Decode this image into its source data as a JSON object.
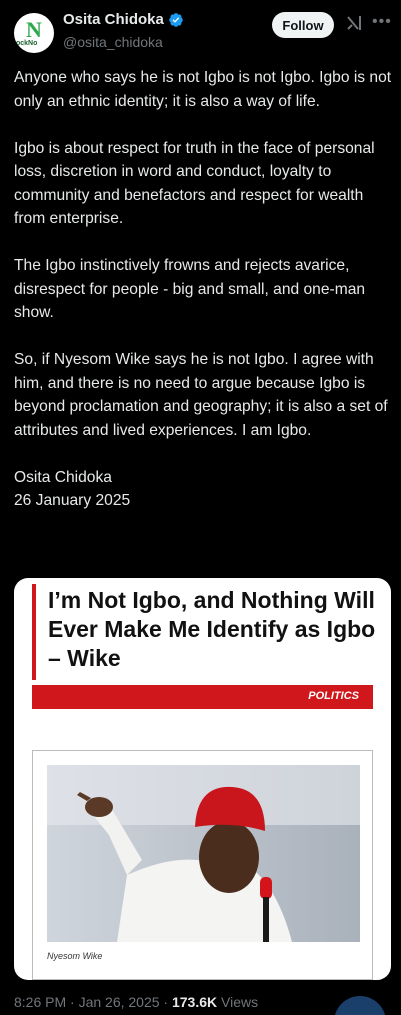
{
  "header": {
    "avatar_text": "N",
    "avatar_small_text": "ockNo",
    "name": "Osita Chidoka",
    "handle": "@osita_chidoka",
    "follow_label": "Follow",
    "icons": {
      "verified": "verified-badge-icon",
      "grok": "grok-icon",
      "more": "more-options-icon"
    }
  },
  "tweet": {
    "paragraphs": [
      "Anyone who says he is not Igbo is not Igbo. Igbo is not only an ethnic identity; it is also a way of life.",
      "Igbo is about respect for truth in the face of personal loss, discretion in word and conduct, loyalty to community and benefactors and respect for wealth from enterprise.",
      "The Igbo instinctively frowns and rejects avarice, disrespect for people - big and small, and one-man show.",
      "So, if  Nyesom Wike says he is not Igbo. I agree with him, and there is no need to argue because Igbo is beyond proclamation and geography; it is also a set of attributes and lived experiences. I am Igbo.",
      "Osita Chidoka\n26 January 2025"
    ]
  },
  "card": {
    "headline": "I’m Not Igbo, and Nothing Will Ever Make Me Identify as Igbo – Wike",
    "category": "POLITICS",
    "photo_caption": "Nyesom Wike"
  },
  "footer": {
    "time": "8:26 PM · Jan 26, 2025 · ",
    "views_count": "173.6K",
    "views_label": " Views"
  },
  "colors": {
    "background": "#000000",
    "text": "#e7e9ea",
    "muted": "#71767b",
    "verified": "#1d9bf0",
    "accent_red": "#d0171c"
  }
}
